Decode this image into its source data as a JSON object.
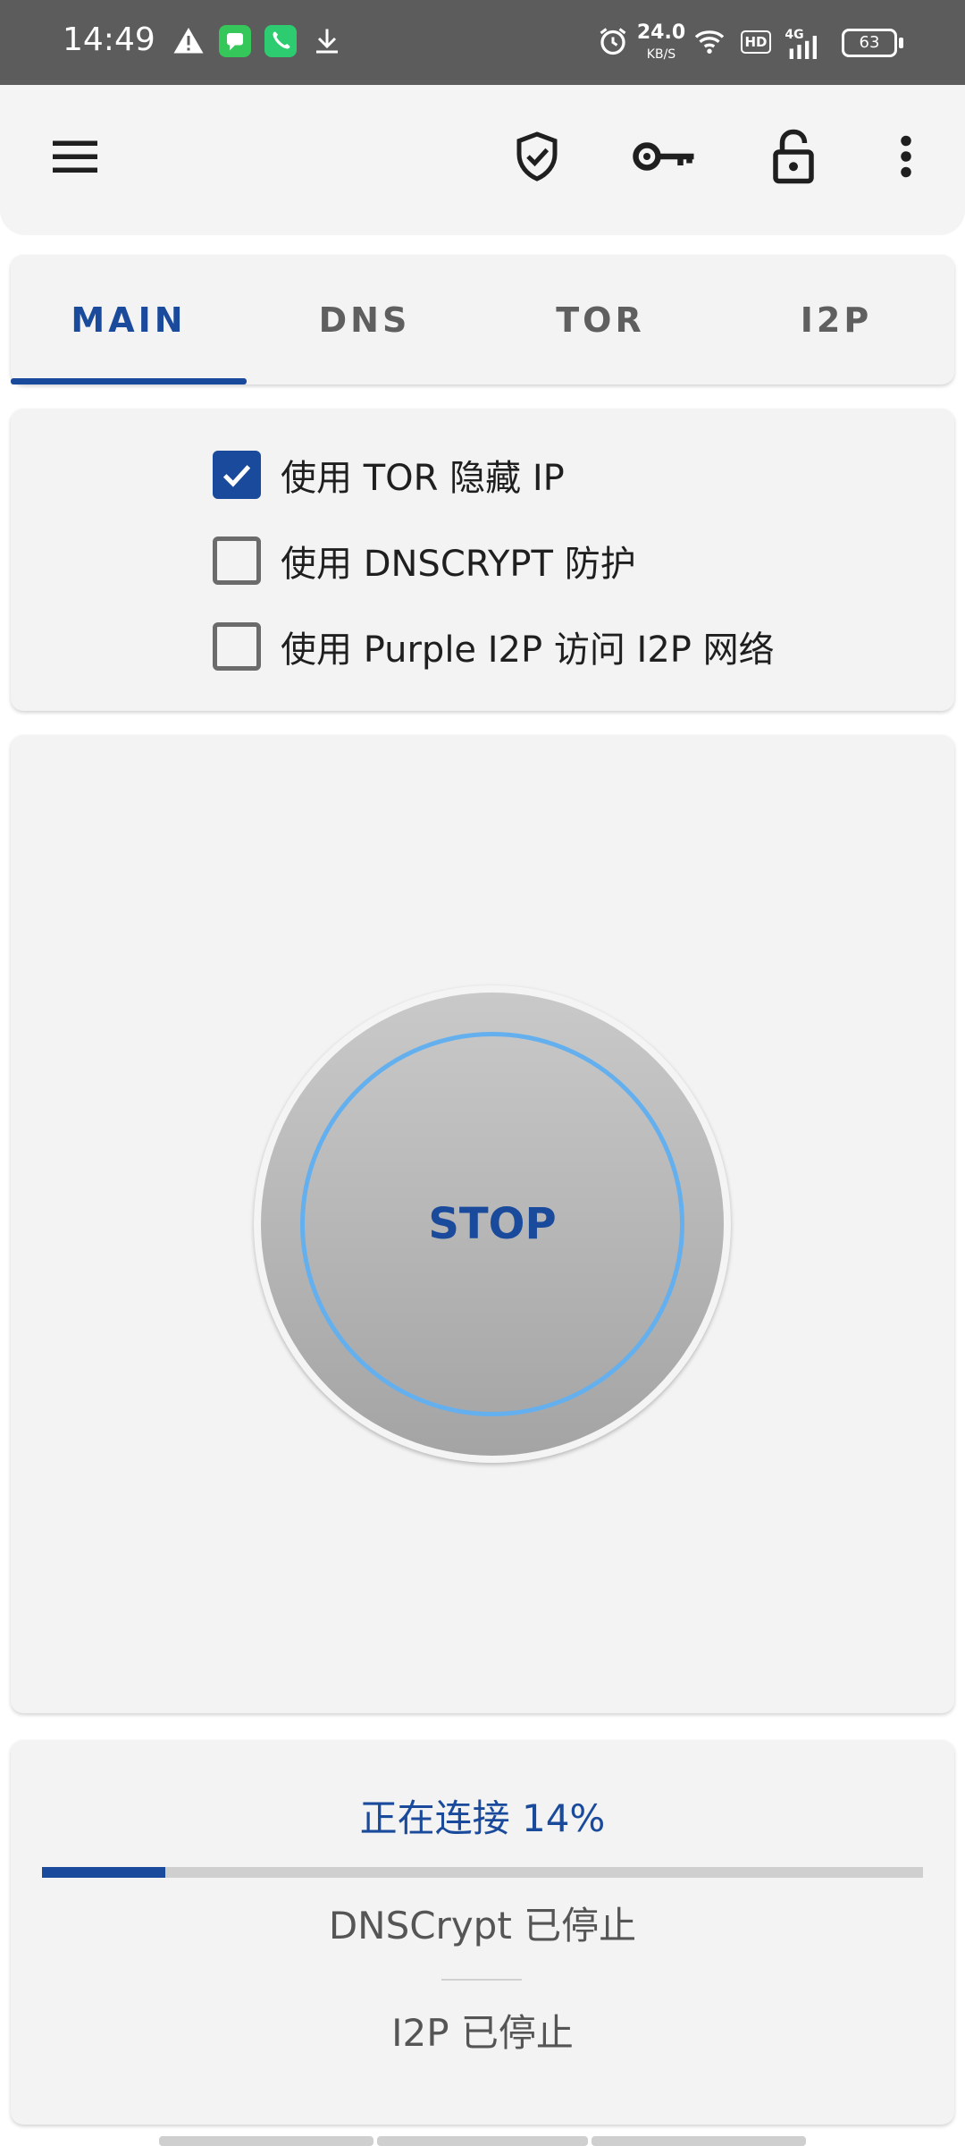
{
  "status_bar": {
    "time": "14:49",
    "net_speed_value": "24.0",
    "net_speed_unit": "KB/S",
    "hd_label": "HD",
    "signal_label": "4G",
    "battery": "63"
  },
  "app_bar": {
    "icons": [
      "menu-icon",
      "shield-check-icon",
      "key-icon",
      "lock-icon",
      "more-vert-icon"
    ]
  },
  "tabs": [
    {
      "label": "MAIN",
      "active": true
    },
    {
      "label": "DNS",
      "active": false
    },
    {
      "label": "TOR",
      "active": false
    },
    {
      "label": "I2P",
      "active": false
    }
  ],
  "options": [
    {
      "label": "使用 TOR 隐藏 IP",
      "checked": true
    },
    {
      "label": "使用 DNSCRYPT 防护",
      "checked": false
    },
    {
      "label": "使用 Purple I2P 访问 I2P 网络",
      "checked": false
    }
  ],
  "main_button": {
    "label": "STOP"
  },
  "status": {
    "connecting": "正在连接 14%",
    "progress_percent": 14,
    "dnscrypt": "DNSCrypt 已停止",
    "i2p": "I2P 已停止"
  },
  "colors": {
    "accent": "#1a4a9b",
    "ring": "#64b0ef",
    "statusbar": "#5c5c5c"
  }
}
